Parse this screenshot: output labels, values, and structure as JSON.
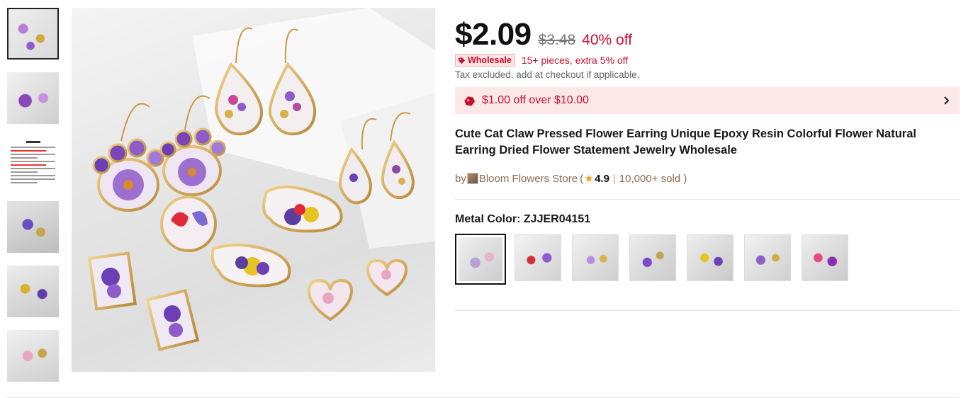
{
  "thumbnails": [
    {
      "name": "thumbnail-1",
      "active": true
    },
    {
      "name": "thumbnail-2",
      "active": false
    },
    {
      "name": "thumbnail-3",
      "active": false
    },
    {
      "name": "thumbnail-4",
      "active": false
    },
    {
      "name": "thumbnail-5",
      "active": false
    },
    {
      "name": "thumbnail-6",
      "active": false
    }
  ],
  "price": {
    "current": "$2.09",
    "original": "$3.48",
    "discount": "40% off"
  },
  "wholesale": {
    "badge_label": "Wholesale",
    "offer_text": "15+ pieces, extra 5% off",
    "badge_icon": "tag-icon"
  },
  "tax_note": "Tax excluded, add at checkout if applicable.",
  "coupon": {
    "icon": "coupon-tag-icon",
    "text": "$1.00 off over $10.00",
    "chevron_icon": "chevron-right-icon"
  },
  "product_title": "Cute Cat Claw Pressed Flower Earring Unique Epoxy Resin Colorful Flower Natural Earring Dried Flower Statement Jewelry Wholesale",
  "store": {
    "by_label": "by",
    "name": "Bloom Flowers Store",
    "open_paren": "(",
    "rating": "4.9",
    "separator": "|",
    "sold": "10,000+ sold )"
  },
  "variant": {
    "label": "Metal Color: ZJJER04151",
    "swatch_count": 7,
    "selected_index": 0
  },
  "colors": {
    "accent_red": "#c8102e",
    "coupon_bg": "#fde8e8",
    "store_brown": "#8a6a50",
    "star_gold": "#f5a623"
  }
}
